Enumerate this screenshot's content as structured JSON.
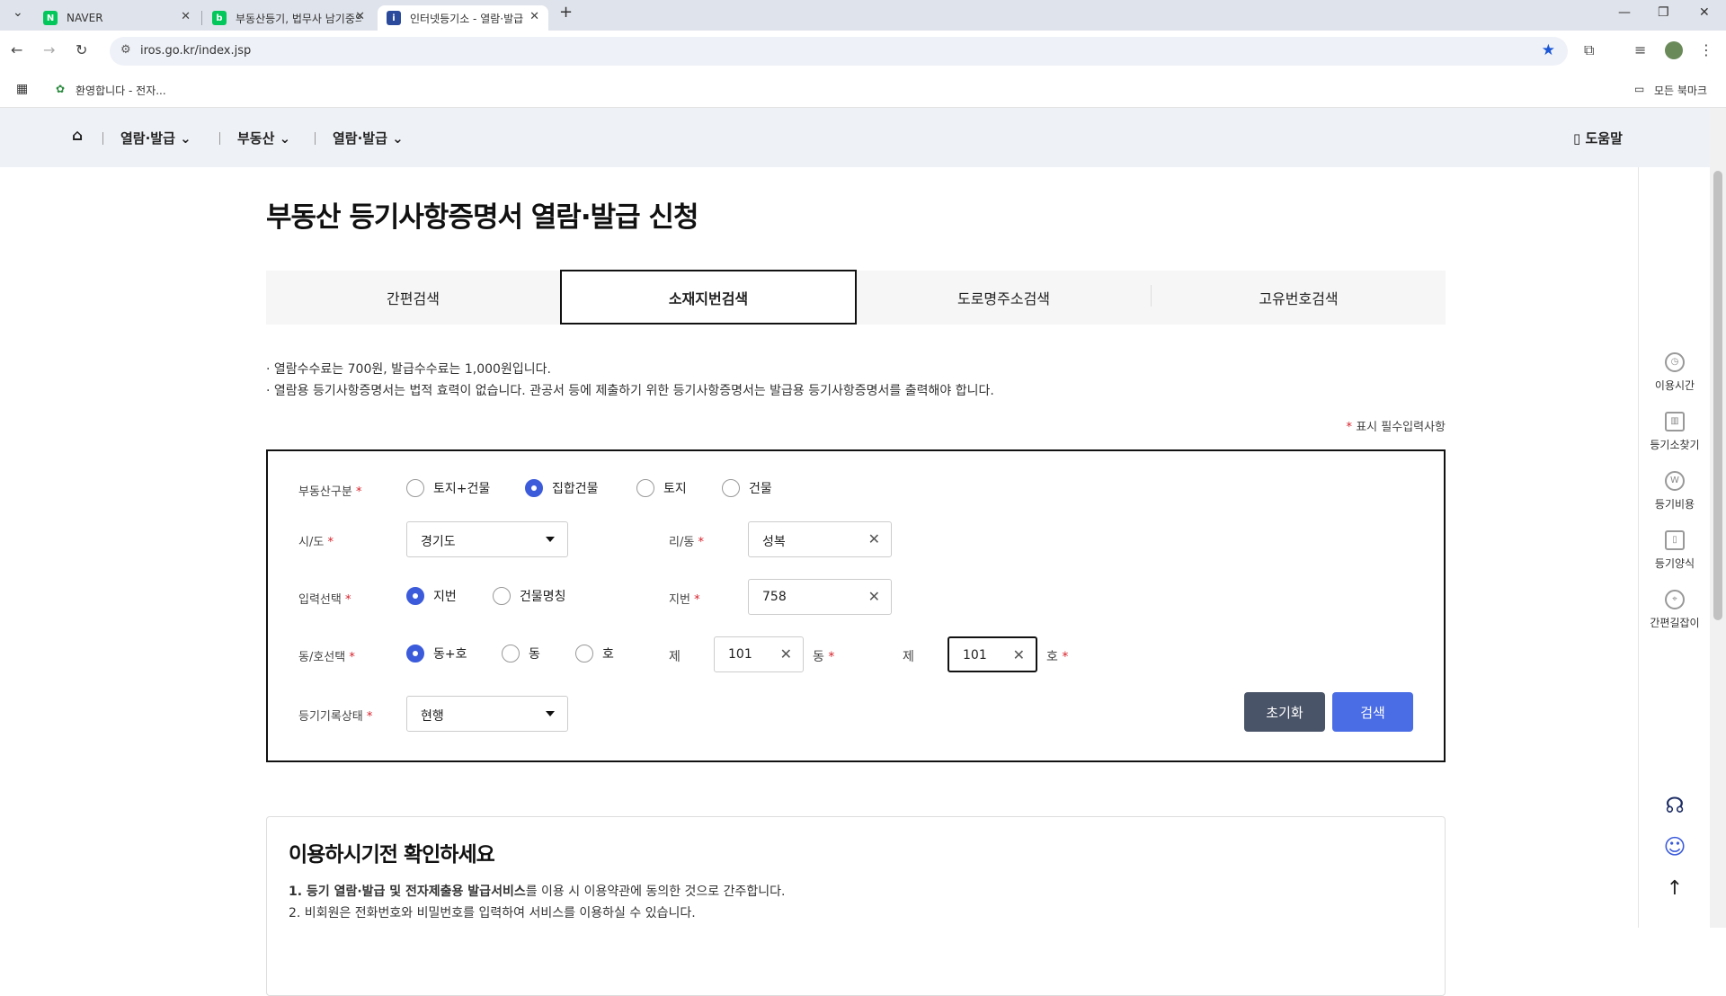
{
  "browser": {
    "tabs": [
      {
        "title": "NAVER",
        "favicon": "N"
      },
      {
        "title": "부동산등기, 법무사 남기중의 ",
        "favicon": "b"
      },
      {
        "title": "인터넷등기소 - 열람·발급",
        "favicon": "i"
      }
    ],
    "new_tab": "+",
    "url": "iros.go.kr/index.jsp",
    "bookmark": "환영합니다 - 전자...",
    "all_bookmarks": "모든 북마크"
  },
  "site_nav": {
    "items": [
      "열람·발급",
      "부동산",
      "열람·발급"
    ],
    "help": "도움말"
  },
  "page": {
    "title": "부동산 등기사항증명서 열람·발급 신청",
    "search_tabs": [
      "간편검색",
      "소재지번검색",
      "도로명주소검색",
      "고유번호검색"
    ],
    "active_tab": "소재지번검색",
    "notice1": "· 열람수수료는  700원, 발급수수료는  1,000원입니다.",
    "notice2": "· 열람용 등기사항증명서는 법적 효력이 없습니다. 관공서 등에 제출하기 위한 등기사항증명서는 발급용 등기사항증명서를 출력해야 합니다.",
    "required_star": "*",
    "required_note": "표시 필수입력사항"
  },
  "form": {
    "property_type": {
      "label": "부동산구분",
      "options": [
        "토지+건물",
        "집합건물",
        "토지",
        "건물"
      ],
      "selected": "집합건물"
    },
    "sido": {
      "label": "시/도",
      "value": "경기도"
    },
    "ri_dong": {
      "label": "리/동",
      "value": "성복"
    },
    "input_type": {
      "label": "입력선택",
      "options": [
        "지번",
        "건물명칭"
      ],
      "selected": "지번"
    },
    "jibun": {
      "label": "지번",
      "value": "758"
    },
    "dongho_type": {
      "label": "동/호선택",
      "options": [
        "동+호",
        "동",
        "호"
      ],
      "selected": "동+호"
    },
    "dong_prefix": "제",
    "dong_value": "101",
    "dong_suffix": "동",
    "ho_prefix": "제",
    "ho_value": "101",
    "ho_suffix": "호",
    "record_status": {
      "label": "등기기록상태",
      "value": "현행"
    },
    "reset_button": "초기화",
    "search_button": "검색",
    "reset_color": "#4a5468",
    "search_color": "#4a6de5"
  },
  "guide": {
    "title": "이용하시기전 확인하세요",
    "item1_bold": "1. 등기 열람·발급 및 전자제출용 발급서비스",
    "item1_rest": "를 이용 시 이용약관에 동의한 것으로 간주합니다.",
    "item2": "2. 비회원은 전화번호와 비밀번호를 입력하여 서비스를 이용하실 수 있습니다."
  },
  "quick_menu": [
    "이용시간",
    "등기소찾기",
    "등기비용",
    "등기양식",
    "간편길잡이"
  ]
}
